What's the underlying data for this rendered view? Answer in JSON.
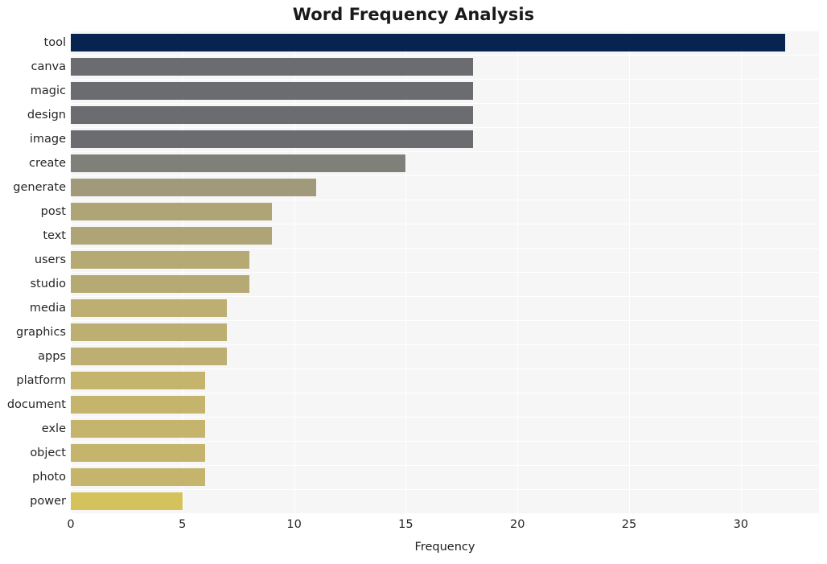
{
  "chart_data": {
    "type": "bar",
    "orientation": "horizontal",
    "title": "Word Frequency Analysis",
    "xlabel": "Frequency",
    "ylabel": "",
    "categories": [
      "tool",
      "canva",
      "magic",
      "design",
      "image",
      "create",
      "generate",
      "post",
      "text",
      "users",
      "studio",
      "media",
      "graphics",
      "apps",
      "platform",
      "document",
      "exle",
      "object",
      "photo",
      "power"
    ],
    "values": [
      32,
      18,
      18,
      18,
      18,
      15,
      11,
      9,
      9,
      8,
      8,
      7,
      7,
      7,
      6,
      6,
      6,
      6,
      6,
      5
    ],
    "bar_colors": [
      "#06244f",
      "#6b6c70",
      "#6b6c70",
      "#6b6c70",
      "#6b6c70",
      "#80807b",
      "#a09a7a",
      "#aea476",
      "#aea476",
      "#b6aa74",
      "#b6aa74",
      "#bdaf72",
      "#bdaf72",
      "#bdaf72",
      "#c5b56c",
      "#c5b56c",
      "#c5b56c",
      "#c5b56c",
      "#c5b56c",
      "#d4c35c"
    ],
    "xlim": [
      0,
      33.5
    ],
    "xticks": [
      0,
      5,
      10,
      15,
      20,
      25,
      30
    ],
    "xticklabels": [
      "0",
      "5",
      "10",
      "15",
      "20",
      "25",
      "30"
    ],
    "grid": true,
    "grid_color": "#ffffff",
    "plot_background": "#f6f6f7",
    "figure_background": "#ffffff",
    "legend": null
  }
}
